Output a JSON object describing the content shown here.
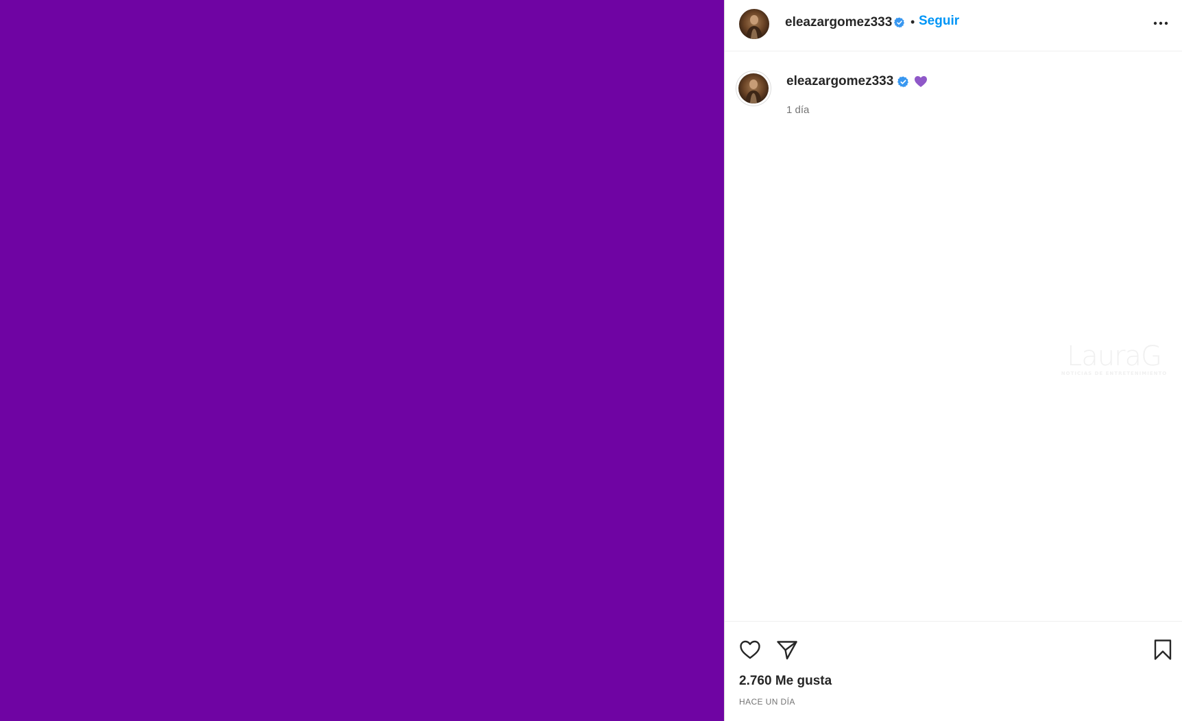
{
  "media": {
    "background_color": "#6F04A3"
  },
  "header": {
    "username": "eleazargomez333",
    "separator": "•",
    "follow_label": "Seguir",
    "verified_icon": "verified-badge-icon",
    "more_icon": "more-options-icon"
  },
  "caption": {
    "username": "eleazargomez333",
    "emoji": "purple-heart",
    "time": "1 día"
  },
  "watermark": {
    "text": "LauraG",
    "subtext": "NOTICIAS DE ENTRETENIMIENTO"
  },
  "actions": {
    "like_icon": "heart-outline-icon",
    "share_icon": "paper-plane-icon",
    "save_icon": "bookmark-icon",
    "likes": "2.760 Me gusta",
    "date": "HACE UN DÍA"
  },
  "colors": {
    "accent": "#0095f6",
    "verified": "#3897f0",
    "purple_heart": "#8f58c8",
    "text": "#262626",
    "muted": "#737373"
  }
}
